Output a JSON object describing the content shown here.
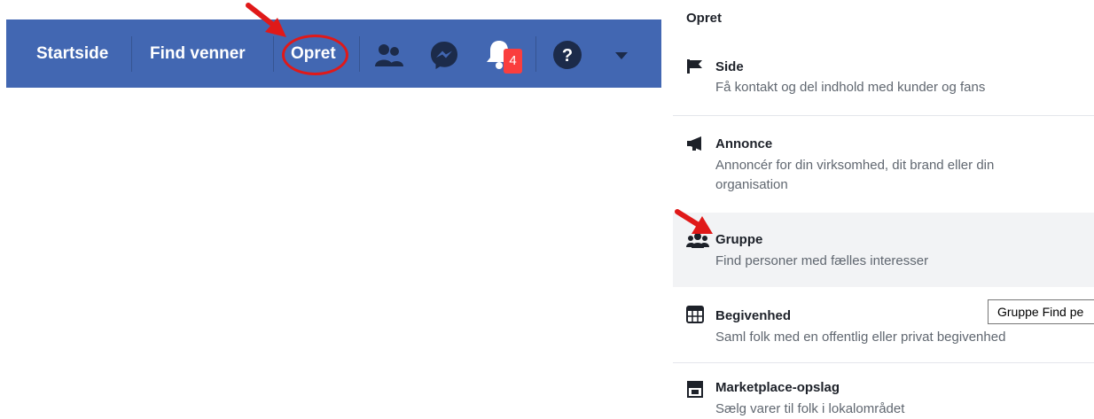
{
  "topbar": {
    "nav": [
      "Startside",
      "Find venner",
      "Opret"
    ],
    "notification_badge": "4",
    "icons": [
      "friends-icon",
      "messenger-icon",
      "notifications-bell-icon",
      "help-icon",
      "account-menu-caret-icon"
    ]
  },
  "menu": {
    "header": "Opret",
    "items": [
      {
        "icon": "flag-icon",
        "title": "Side",
        "desc": "Få kontakt og del indhold med kunder og fans"
      },
      {
        "icon": "megaphone-icon",
        "title": "Annonce",
        "desc": "Annoncér for din virksomhed, dit brand eller din organisation"
      },
      {
        "icon": "group-icon",
        "title": "Gruppe",
        "desc": "Find personer med fælles interesser"
      },
      {
        "icon": "calendar-icon",
        "title": "Begivenhed",
        "desc": "Saml folk med en offentlig eller privat begivenhed"
      },
      {
        "icon": "storefront-icon",
        "title": "Marketplace-opslag",
        "desc": "Sælg varer til folk i lokalområdet"
      }
    ],
    "tooltip": "Gruppe Find pe"
  },
  "colors": {
    "topbar_bg": "#4267b2",
    "annotation_red": "#e01919",
    "badge_red": "#fa3e3e",
    "selected_row_bg": "#f2f3f5"
  }
}
